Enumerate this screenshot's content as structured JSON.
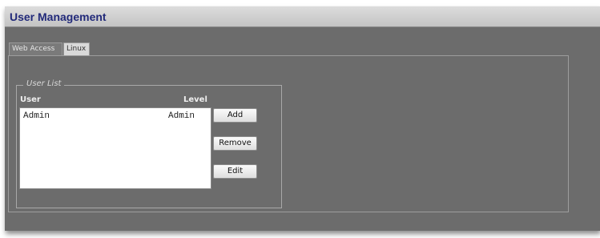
{
  "window": {
    "title": "User Management"
  },
  "tabs": [
    {
      "label": "Web Access",
      "active": true
    },
    {
      "label": "Linux",
      "active": false
    }
  ],
  "user_list": {
    "legend": "User List",
    "columns": [
      "User",
      "Level"
    ],
    "rows": [
      {
        "user": "Admin",
        "level": "Admin"
      }
    ]
  },
  "buttons": {
    "add": "Add",
    "remove": "Remove",
    "edit": "Edit"
  }
}
